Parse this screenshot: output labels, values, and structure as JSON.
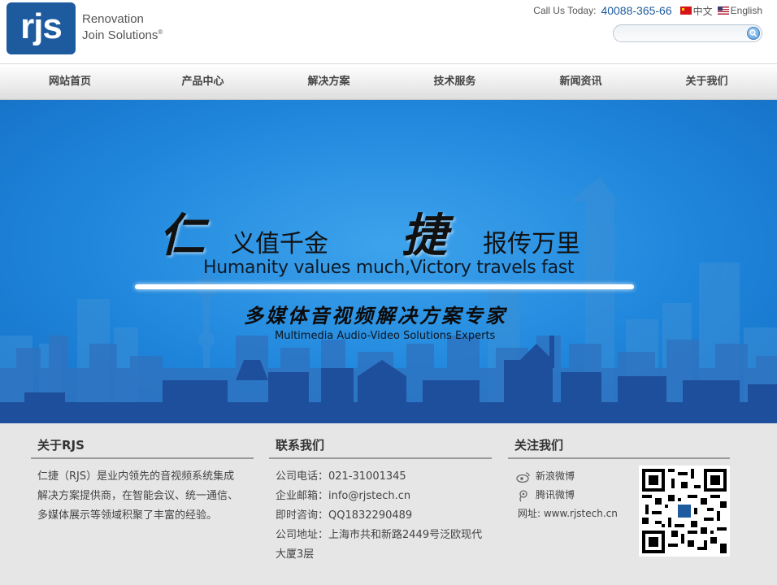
{
  "header": {
    "logo_mark": "rjs",
    "logo_line1": "Renovation",
    "logo_line2": "Join Solutions",
    "logo_reg": "®",
    "call_label": "Call Us Today:",
    "phone": "40088-365-66",
    "lang_cn": "中文",
    "lang_en": "English",
    "search_placeholder": ""
  },
  "nav": {
    "items": [
      "网站首页",
      "产品中心",
      "解决方案",
      "技术服务",
      "新闻资讯",
      "关于我们"
    ]
  },
  "banner": {
    "char1": "仁",
    "phrase1": "义值千金",
    "char2": "捷",
    "phrase2": "报传万里",
    "english": "Humanity values much,Victory travels fast",
    "subtitle": "多媒体音视频解决方案专家",
    "subtitle_en": "Multimedia Audio-Video Solutions Experts"
  },
  "footer": {
    "about": {
      "heading": "关于RJS",
      "lines": [
        "仁捷（RJS）是业内领先的音视频系统集成",
        "解决方案提供商，在智能会议、统一通信、",
        "多媒体展示等领域积聚了丰富的经验。"
      ]
    },
    "contact": {
      "heading": "联系我们",
      "lines": [
        "公司电话：021-31001345",
        "企业邮箱：info@rjstech.cn",
        "即时咨询：QQ1832290489",
        "公司地址：上海市共和新路2449号泛欧现代",
        "大厦3层"
      ]
    },
    "follow": {
      "heading": "关注我们",
      "weibo_sina": "新浪微博",
      "weibo_tencent": "腾讯微博",
      "website": "网址: www.rjstech.cn"
    }
  },
  "colors": {
    "brand": "#1d5a9e",
    "banner_blue": "#1f86dc",
    "footer_bg": "#e6e6e6"
  }
}
